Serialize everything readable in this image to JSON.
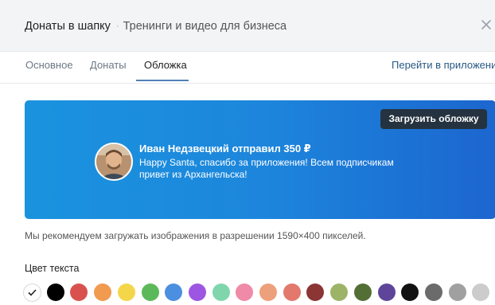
{
  "header": {
    "title": "Донаты в шапку",
    "separator": "·",
    "subtitle": "Тренинги и видео для бизнеса",
    "close_icon": "close-icon"
  },
  "tabs": [
    {
      "label": "Основное",
      "active": false
    },
    {
      "label": "Донаты",
      "active": false
    },
    {
      "label": "Обложка",
      "active": true
    }
  ],
  "open_app_link": "Перейти в приложение",
  "cover": {
    "upload_button": "Загрузить обложку",
    "donor_name": "Иван Недзвецкий отправил 350 ₽",
    "donor_message": "Happy Santa, спасибо за приложения! Всем подписчикам привет из Архангельска!",
    "gradient_start": "#1a93de",
    "gradient_end": "#1c66cf"
  },
  "hint": "Мы рекомендуем загружать изображения в разрешении 1590×400 пикселей.",
  "text_color_label": "Цвет текста",
  "colors": [
    "#ffffff",
    "#000000",
    "#d9514e",
    "#f09b4f",
    "#f4d64a",
    "#5cb95a",
    "#4c8fe0",
    "#9d56e2",
    "#7fd6ad",
    "#ef8aa8",
    "#eca07c",
    "#e3786d",
    "#8b3535",
    "#9db468",
    "#546f36",
    "#5e4599",
    "#111111",
    "#6b6b6b",
    "#a0a0a0",
    "#cccccc"
  ],
  "selected_color_index": 0
}
